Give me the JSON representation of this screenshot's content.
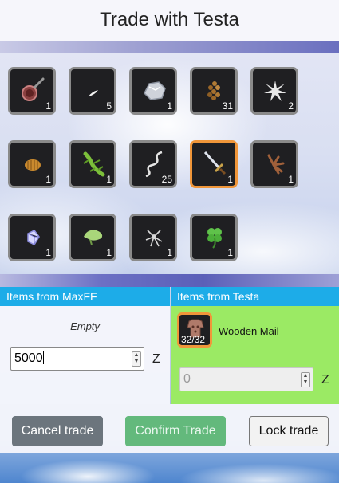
{
  "window": {
    "title": "Trade with Testa"
  },
  "inventory": [
    {
      "icon": "frying-pan-icon",
      "qty": "1",
      "selected": false
    },
    {
      "icon": "feather-icon",
      "qty": "5",
      "selected": false
    },
    {
      "icon": "silver-ore-icon",
      "qty": "1",
      "selected": false
    },
    {
      "icon": "seed-cluster-icon",
      "qty": "31",
      "selected": false
    },
    {
      "icon": "white-fur-icon",
      "qty": "2",
      "selected": false
    },
    {
      "icon": "grub-icon",
      "qty": "1",
      "selected": false
    },
    {
      "icon": "lizard-icon",
      "qty": "1",
      "selected": false
    },
    {
      "icon": "rope-icon",
      "qty": "25",
      "selected": false
    },
    {
      "icon": "sword-icon",
      "qty": "1",
      "selected": true
    },
    {
      "icon": "claw-icon",
      "qty": "1",
      "selected": false
    },
    {
      "icon": "crystal-icon",
      "qty": "1",
      "selected": false
    },
    {
      "icon": "leaf-icon",
      "qty": "1",
      "selected": false
    },
    {
      "icon": "spider-icon",
      "qty": "1",
      "selected": false
    },
    {
      "icon": "clover-icon",
      "qty": "1",
      "selected": false
    }
  ],
  "my_offer": {
    "header": "Items from MaxFF",
    "empty_label": "Empty",
    "zeny_value": "5000",
    "zeny_unit": "Z"
  },
  "their_offer": {
    "header": "Items from Testa",
    "items": [
      {
        "icon": "wooden-mail-icon",
        "name": "Wooden Mail",
        "qty": "32/32"
      }
    ],
    "zeny_placeholder": "0",
    "zeny_unit": "Z"
  },
  "buttons": {
    "cancel": "Cancel trade",
    "confirm": "Confirm Trade",
    "lock": "Lock trade"
  },
  "colors": {
    "header_blue": "#1dace8",
    "their_panel_green": "#9bea64",
    "selected_border": "#f0963a",
    "cancel_gray": "#6c757d",
    "confirm_green": "#63b97c"
  }
}
